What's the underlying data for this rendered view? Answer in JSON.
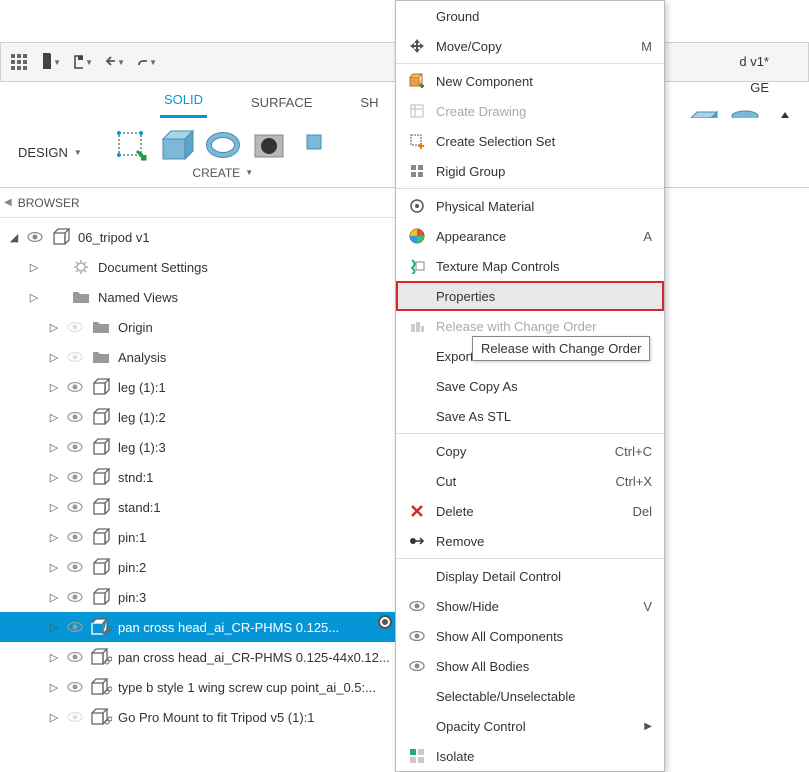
{
  "doc_title_suffix": "d v1*",
  "right_tab_suffix": "GE",
  "toolbar": {
    "design_label": "DESIGN"
  },
  "tabs": {
    "solid": "SOLID",
    "surface": "SURFACE",
    "sheet_prefix": "SH"
  },
  "ribbon": {
    "create_label": "CREATE"
  },
  "browser": {
    "title": "BROWSER",
    "root": "06_tripod v1",
    "items": [
      {
        "label": "Document Settings",
        "icon": "gear",
        "indent": 1,
        "eye": false,
        "expander": true
      },
      {
        "label": "Named Views",
        "icon": "folder",
        "indent": 1,
        "eye": false,
        "expander": true
      },
      {
        "label": "Origin",
        "icon": "folder",
        "indent": 2,
        "eye": true,
        "eye_hidden": true,
        "expander": true
      },
      {
        "label": "Analysis",
        "icon": "folder",
        "indent": 2,
        "eye": true,
        "eye_hidden": true,
        "expander": true
      },
      {
        "label": "leg (1):1",
        "icon": "component",
        "indent": 2,
        "eye": true,
        "expander": true
      },
      {
        "label": "leg (1):2",
        "icon": "component",
        "indent": 2,
        "eye": true,
        "expander": true
      },
      {
        "label": "leg (1):3",
        "icon": "component",
        "indent": 2,
        "eye": true,
        "expander": true
      },
      {
        "label": "stnd:1",
        "icon": "component",
        "indent": 2,
        "eye": true,
        "expander": true
      },
      {
        "label": "stand:1",
        "icon": "component",
        "indent": 2,
        "eye": true,
        "expander": true
      },
      {
        "label": "pin:1",
        "icon": "component",
        "indent": 2,
        "eye": true,
        "expander": true
      },
      {
        "label": "pin:2",
        "icon": "component",
        "indent": 2,
        "eye": true,
        "expander": true
      },
      {
        "label": "pin:3",
        "icon": "component",
        "indent": 2,
        "eye": true,
        "expander": true
      },
      {
        "label": "pan cross head_ai_CR-PHMS 0.125...",
        "icon": "component-link",
        "indent": 2,
        "eye": true,
        "expander": true,
        "selected": true
      },
      {
        "label": "pan cross head_ai_CR-PHMS 0.125-44x0.12...",
        "icon": "component-link",
        "indent": 2,
        "eye": true,
        "expander": true
      },
      {
        "label": "type b style 1 wing screw cup point_ai_0.5:...",
        "icon": "component-link",
        "indent": 2,
        "eye": true,
        "expander": true
      },
      {
        "label": "Go Pro Mount to fit Tripod v5 (1):1",
        "icon": "component-link",
        "indent": 2,
        "eye": true,
        "eye_hidden": true,
        "expander": true
      }
    ]
  },
  "context_menu": {
    "items": [
      {
        "label": "Ground",
        "icon": ""
      },
      {
        "label": "Move/Copy",
        "icon": "move",
        "shortcut": "M"
      },
      {
        "separator": true
      },
      {
        "label": "New Component",
        "icon": "new-comp"
      },
      {
        "label": "Create Drawing",
        "icon": "drawing",
        "disabled": true
      },
      {
        "label": "Create Selection Set",
        "icon": "selection"
      },
      {
        "label": "Rigid Group",
        "icon": "rigid"
      },
      {
        "separator": true
      },
      {
        "label": "Physical Material",
        "icon": "material"
      },
      {
        "label": "Appearance",
        "icon": "appearance",
        "shortcut": "A"
      },
      {
        "label": "Texture Map Controls",
        "icon": "texture"
      },
      {
        "label": "Properties",
        "icon": "",
        "highlighted": true
      },
      {
        "label": "Release with Change Order",
        "icon": "release",
        "disabled": true
      },
      {
        "label": "Export...",
        "icon": ""
      },
      {
        "label": "Save Copy As",
        "icon": ""
      },
      {
        "label": "Save As STL",
        "icon": ""
      },
      {
        "separator": true
      },
      {
        "label": "Copy",
        "icon": "",
        "shortcut": "Ctrl+C"
      },
      {
        "label": "Cut",
        "icon": "",
        "shortcut": "Ctrl+X"
      },
      {
        "label": "Delete",
        "icon": "delete",
        "shortcut": "Del"
      },
      {
        "label": "Remove",
        "icon": "remove"
      },
      {
        "separator": true
      },
      {
        "label": "Display Detail Control",
        "icon": ""
      },
      {
        "label": "Show/Hide",
        "icon": "eye",
        "shortcut": "V"
      },
      {
        "label": "Show All Components",
        "icon": "eye"
      },
      {
        "label": "Show All Bodies",
        "icon": "eye"
      },
      {
        "label": "Selectable/Unselectable",
        "icon": ""
      },
      {
        "label": "Opacity Control",
        "icon": "",
        "submenu": true
      },
      {
        "label": "Isolate",
        "icon": "isolate"
      }
    ]
  },
  "tooltip": "Release with Change Order"
}
